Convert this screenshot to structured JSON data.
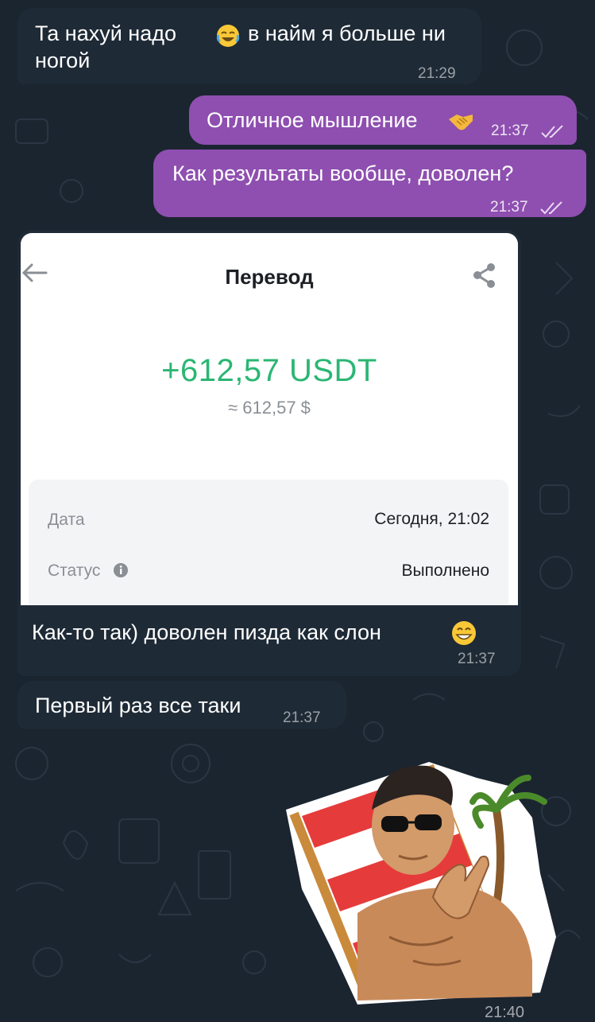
{
  "messages": [
    {
      "text_line1": "Та нахуй надо",
      "text_line1b": "в найм я больше ни",
      "text_line2": "ногой",
      "time": "21:29",
      "emoji": "joy-emoji"
    },
    {
      "text": "Отличное мышление",
      "time": "21:37",
      "emoji": "handshake-emoji"
    },
    {
      "text": "Как результаты вообще, доволен?",
      "time": "21:37"
    },
    {
      "caption": "Как-то так)  доволен пизда как слон",
      "time": "21:37",
      "emoji": "grin-emoji"
    },
    {
      "text": "Первый раз все таки",
      "time": "21:37"
    }
  ],
  "transfer": {
    "title": "Перевод",
    "amount": "+612,57 USDT",
    "approx": "≈ 612,57 $",
    "date_label": "Дата",
    "date_value": "Сегодня, 21:02",
    "status_label": "Статус",
    "status_value": "Выполнено",
    "back_icon": "arrow-left-icon",
    "share_icon": "share-icon"
  },
  "bottom_time_partial": "21:40",
  "colors": {
    "background": "#1b2530",
    "incoming_bubble": "#1e2a36",
    "outgoing_bubble": "#8e4fb0",
    "amount_green": "#2bb673"
  }
}
